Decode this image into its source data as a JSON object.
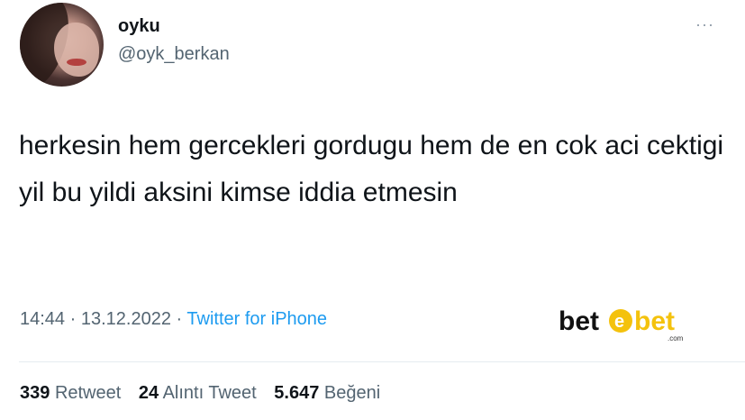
{
  "user": {
    "display_name": "oyku",
    "handle": "@oyk_berkan",
    "avatar_icon": "profile-photo"
  },
  "menu": {
    "more_label": "···"
  },
  "tweet": {
    "text": "herkesin hem gercekleri gordugu hem de en cok aci cektigi yil bu yildi aksini kimse iddia etmesin"
  },
  "meta": {
    "time": "14:44",
    "separator": "·",
    "date": "13.12.2022",
    "source": "Twitter for iPhone"
  },
  "watermark": {
    "text_left": "bet",
    "text_right": "bet",
    "suffix": ".com",
    "accent_color": "#f4c20d"
  },
  "stats": {
    "retweets_count": "339",
    "retweets_label": "Retweet",
    "quotes_count": "24",
    "quotes_label": "Alıntı Tweet",
    "likes_count": "5.647",
    "likes_label": "Beğeni"
  }
}
